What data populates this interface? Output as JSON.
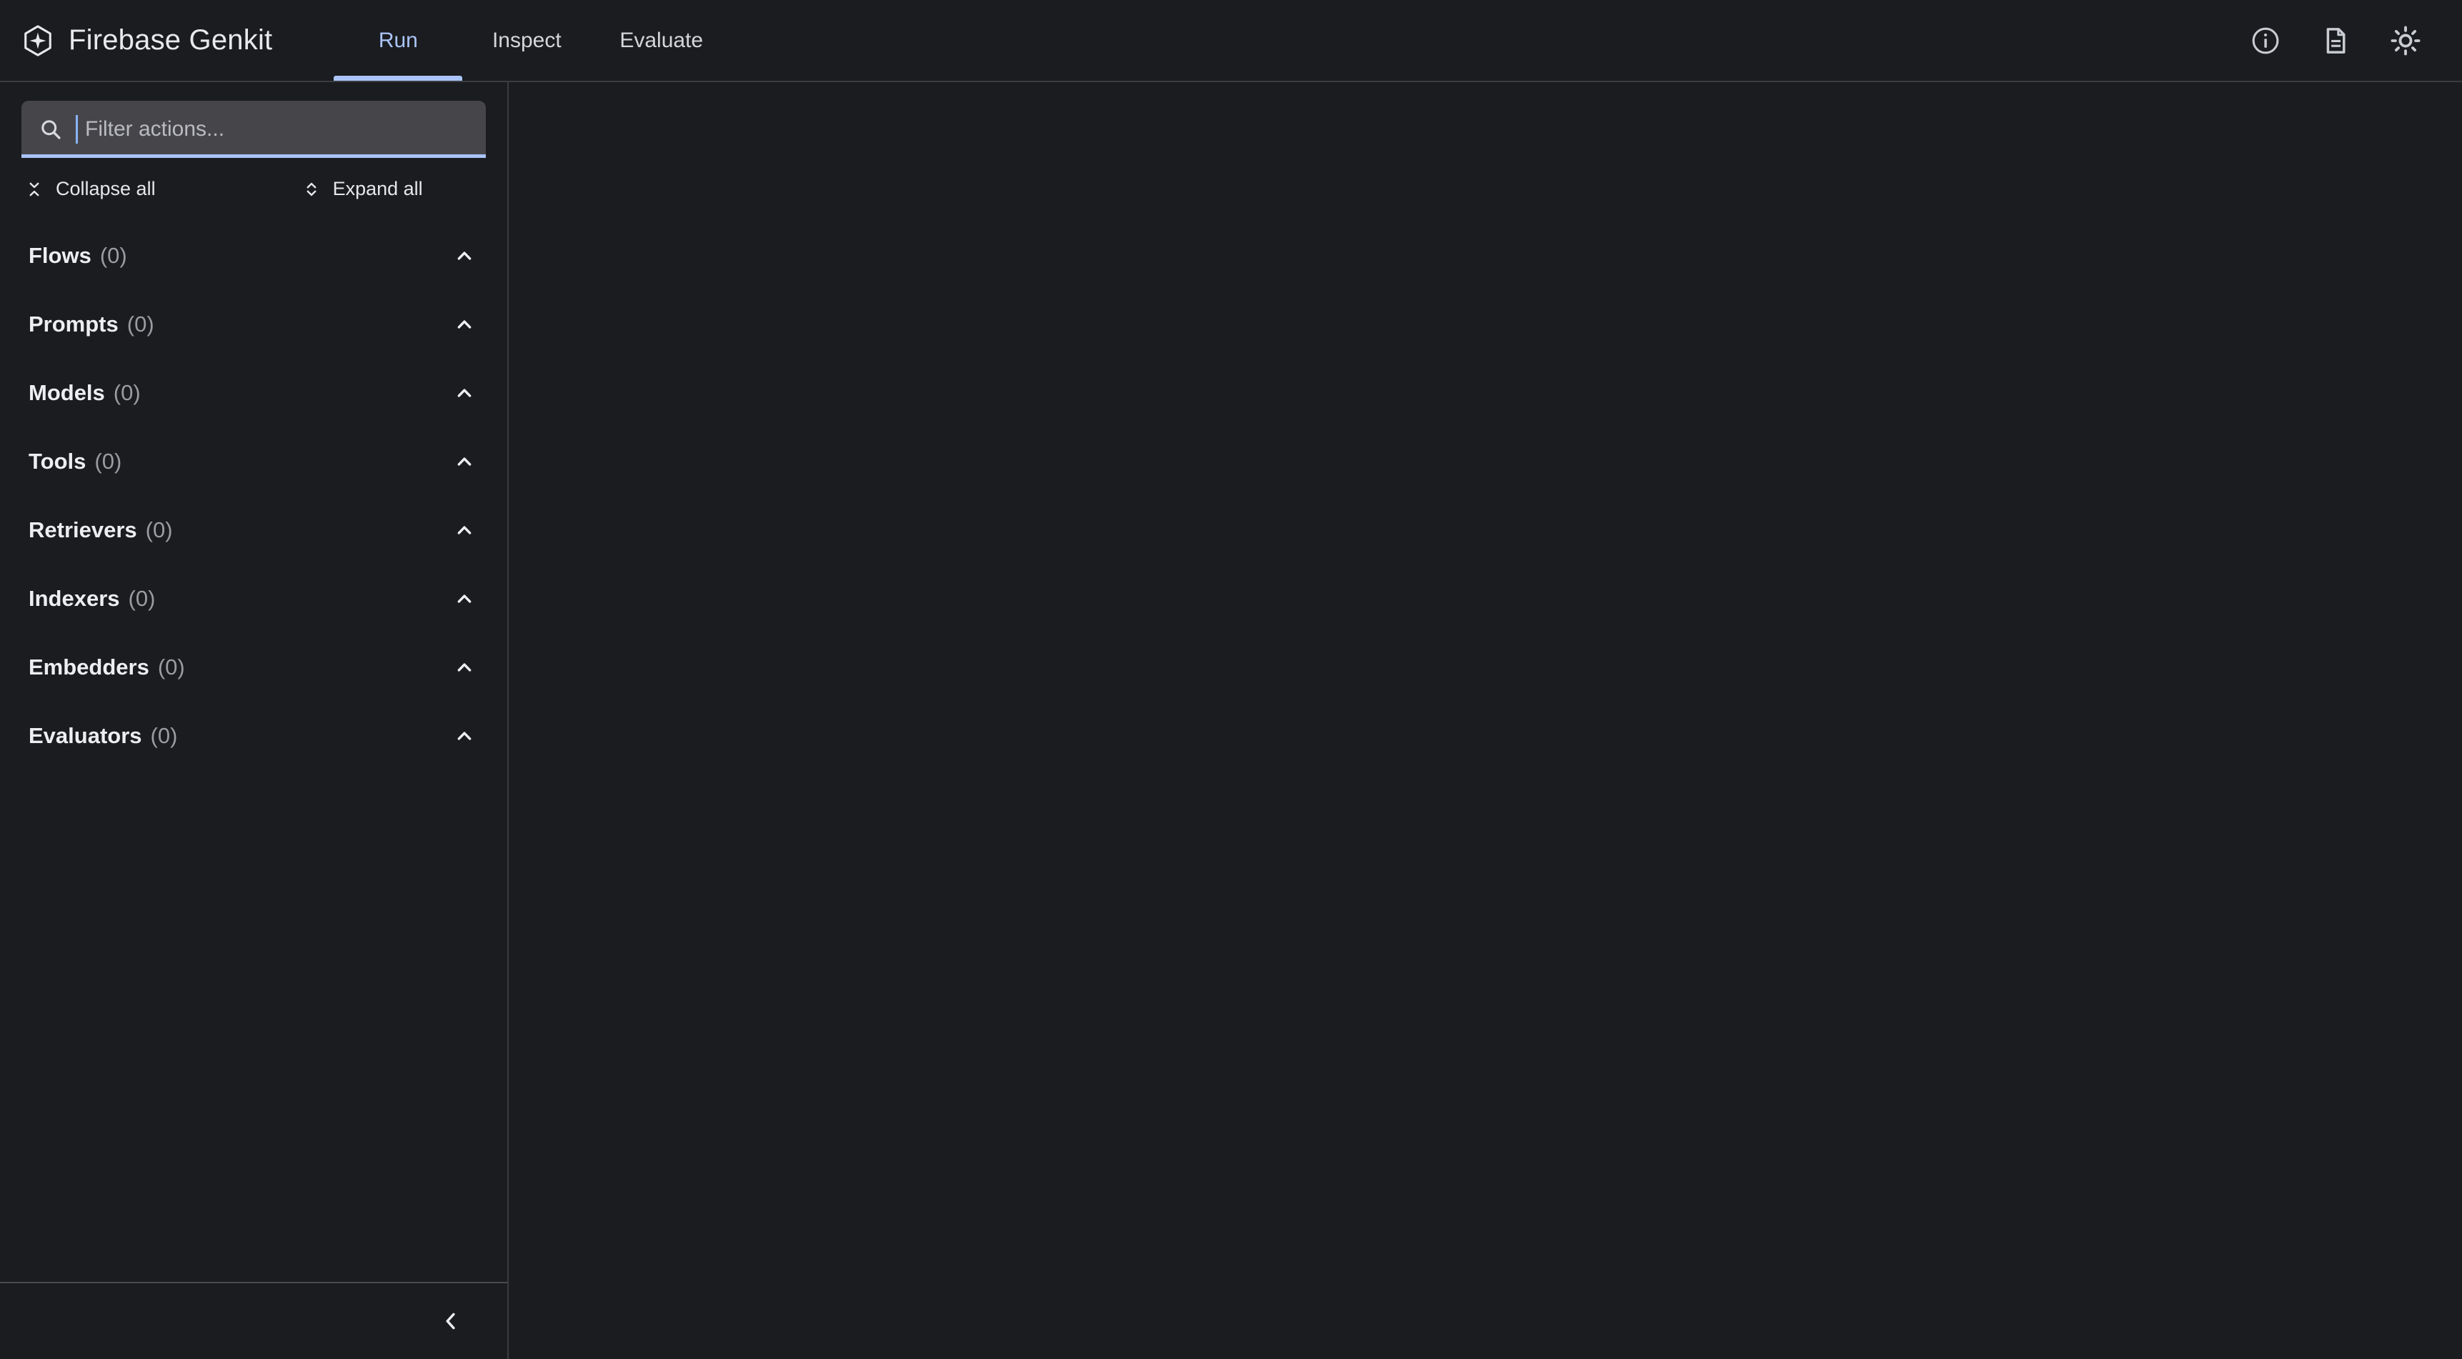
{
  "app": {
    "brand_name": "Firebase Genkit",
    "logo_icon": "genkit-hexagon-sparkle-icon"
  },
  "header": {
    "tabs": [
      {
        "label": "Run",
        "active": true
      },
      {
        "label": "Inspect",
        "active": false
      },
      {
        "label": "Evaluate",
        "active": false
      }
    ],
    "actions": [
      {
        "name": "info-icon",
        "title": "Info"
      },
      {
        "name": "document-icon",
        "title": "Docs"
      },
      {
        "name": "sun-icon",
        "title": "Toggle theme"
      }
    ]
  },
  "sidebar": {
    "search": {
      "placeholder": "Filter actions...",
      "value": "",
      "icon": "search-icon",
      "focused": true
    },
    "tree_controls": {
      "collapse_label": "Collapse all",
      "collapse_icon": "unfold-less-icon",
      "expand_label": "Expand all",
      "expand_icon": "unfold-more-icon"
    },
    "sections": [
      {
        "label": "Flows",
        "count": "(0)",
        "expanded": true,
        "toggle_icon": "chevron-up-icon"
      },
      {
        "label": "Prompts",
        "count": "(0)",
        "expanded": true,
        "toggle_icon": "chevron-up-icon"
      },
      {
        "label": "Models",
        "count": "(0)",
        "expanded": true,
        "toggle_icon": "chevron-up-icon"
      },
      {
        "label": "Tools",
        "count": "(0)",
        "expanded": true,
        "toggle_icon": "chevron-up-icon"
      },
      {
        "label": "Retrievers",
        "count": "(0)",
        "expanded": true,
        "toggle_icon": "chevron-up-icon"
      },
      {
        "label": "Indexers",
        "count": "(0)",
        "expanded": true,
        "toggle_icon": "chevron-up-icon"
      },
      {
        "label": "Embedders",
        "count": "(0)",
        "expanded": true,
        "toggle_icon": "chevron-up-icon"
      },
      {
        "label": "Evaluators",
        "count": "(0)",
        "expanded": true,
        "toggle_icon": "chevron-up-icon"
      }
    ],
    "footer": {
      "collapse_sidebar_icon": "chevron-left-icon"
    }
  },
  "main": {
    "content": ""
  },
  "colors": {
    "background": "#1b1c1f",
    "surface": "#1b1c1f",
    "border": "#3a3c40",
    "divider": "#4a4c50",
    "accent": "#aac4f7",
    "text_primary": "#eceef1",
    "text_secondary": "#9a9ca1",
    "search_background": "#46464a",
    "caret": "#8ab4f8"
  }
}
